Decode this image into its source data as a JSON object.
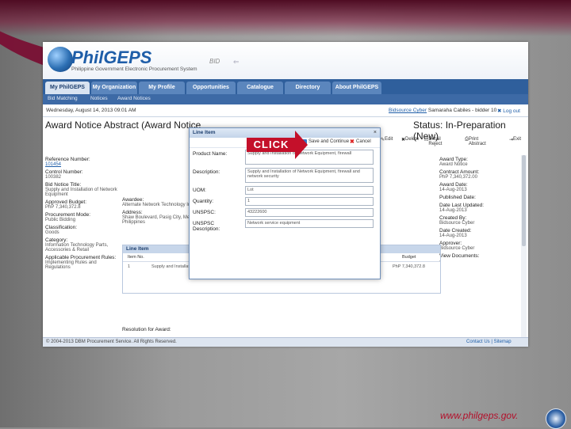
{
  "slide": {
    "url": "www.philgeps.gov."
  },
  "header": {
    "logo_text": "PhilGEPS",
    "logo_sub": "Philippine Government Electronic Procurement System",
    "bid_text": "BID"
  },
  "tabs": [
    "My PhilGEPS",
    "My Organization",
    "My Profile",
    "Opportunities",
    "Catalogue",
    "Directory",
    "About PhilGEPS"
  ],
  "subnav": [
    "Bid Matching",
    "Notices",
    "Award Notices"
  ],
  "datebar": {
    "date": "Wednesday, August 14, 2013 09:01 AM",
    "user_link": "Bidsource Cyber",
    "user_rest": "Samaraha Cabiles - bidder 10",
    "logout": "Log out"
  },
  "page": {
    "title": "Award Notice Abstract (Award Notice",
    "status": "Status: In-Preparation (New)"
  },
  "toolbar": [
    "Edit",
    "Delete",
    "Detail Reject",
    "Print Abstract",
    "Exit"
  ],
  "left_fields": [
    {
      "label": "Reference Number:",
      "value": "101454",
      "link": true
    },
    {
      "label": "Control Number:",
      "value": "100382"
    },
    {
      "label": "Bid Notice Title:",
      "value": "Supply and Installation of Network Equipment"
    },
    {
      "label": "Approved Budget:",
      "value": "PhP 7,340,372.8"
    },
    {
      "label": "Procurement Mode:",
      "value": "Public Bidding"
    },
    {
      "label": "Classification:",
      "value": "Goods"
    },
    {
      "label": "Category:",
      "value": "Information Technology Parts, Accessories & Retail"
    },
    {
      "label": "Applicable Procurement Rules:",
      "value": "Implementing Rules and Regulations"
    }
  ],
  "mid_fields": [
    {
      "label": "Awardee:",
      "value": "Alternate Network Technology Inc."
    },
    {
      "label": "Address:",
      "value": "Shaw Boulevard, Pasig City, Metro Manila, Philippines"
    }
  ],
  "right_fields": [
    {
      "label": "Award Type:",
      "value": "Award Notice"
    },
    {
      "label": "Contract Amount:",
      "value": "PhP 7,340,372.00"
    },
    {
      "label": "Award Date:",
      "value": "14-Aug-2013"
    },
    {
      "label": "Published Date:",
      "value": ""
    },
    {
      "label": "Date Last Updated:",
      "value": "14-Aug-2013"
    },
    {
      "label": "Created By:",
      "value": "Bidsource Cyber"
    },
    {
      "label": "Date Created:",
      "value": "14-Aug-2013"
    },
    {
      "label": "Approver:",
      "value": "Bidsource Cyber"
    },
    {
      "label": "View Documents:",
      "value": "-"
    }
  ],
  "line_items": {
    "title": "Line Item",
    "cols": [
      "Item No.",
      "Budget"
    ],
    "row": {
      "no": "1",
      "desc": "Supply and Installation of Network Equipment, Firewall and Network Security, set 1 lot",
      "amount": "PhP 7,340,372.8"
    }
  },
  "resolution_label": "Resolution for Award:",
  "footer": {
    "copyright": "© 2004-2013 DBM Procurement Service. All Rights Reserved.",
    "links": "Contact Us | Sitemap"
  },
  "modal": {
    "title": "Line Item",
    "close": "×",
    "save": "Save and Continue",
    "cancel": "Cancel",
    "fields": [
      {
        "label": "Product Name:",
        "value": "Supply and Installation of Network Equipment, firewall"
      },
      {
        "label": "Description:",
        "value": "Supply and Installation of Network Equipment, firewall and network security"
      },
      {
        "label": "UOM:",
        "value": "Lot"
      },
      {
        "label": "Quantity:",
        "value": "1"
      },
      {
        "label": "UNSPSC:",
        "value": "43222600"
      },
      {
        "label": "UNSPSC Description:",
        "value": "Network service equipment"
      }
    ]
  },
  "callout": {
    "text": "CLICK",
    "color": "#c4102a"
  }
}
